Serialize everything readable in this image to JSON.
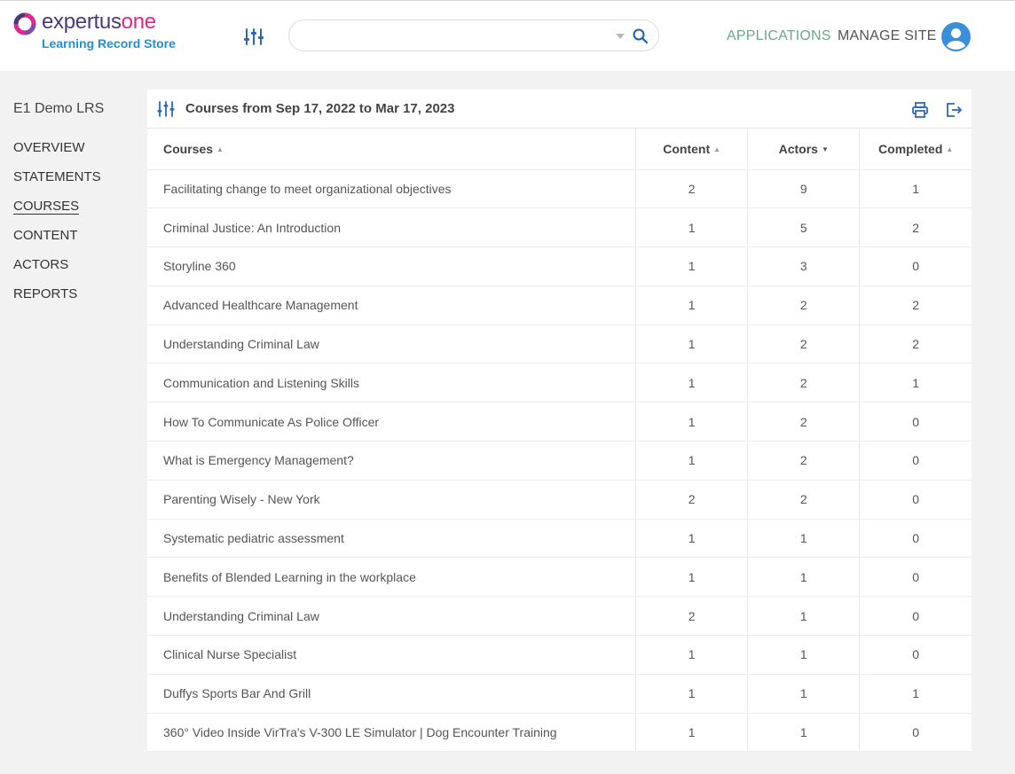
{
  "header": {
    "logo_word_1": "expertus",
    "logo_word_2": "one",
    "logo_subtitle": "Learning Record Store",
    "search": {
      "value": "",
      "placeholder": ""
    },
    "nav": {
      "applications": "APPLICATIONS",
      "manage_site": "MANAGE SITE"
    }
  },
  "colors": {
    "brand_purple": "#4a3a7a",
    "brand_pink": "#e0278a",
    "brand_blue": "#1e90d6",
    "accent_green": "#6aa88a"
  },
  "sidebar": {
    "site_name": "E1 Demo LRS",
    "items": [
      {
        "label": "OVERVIEW",
        "active": false
      },
      {
        "label": "STATEMENTS",
        "active": false
      },
      {
        "label": "COURSES",
        "active": true
      },
      {
        "label": "CONTENT",
        "active": false
      },
      {
        "label": "ACTORS",
        "active": false
      },
      {
        "label": "REPORTS",
        "active": false
      }
    ]
  },
  "panel": {
    "title": "Courses from Sep 17, 2022 to Mar 17, 2023",
    "columns": [
      {
        "label": "Courses",
        "sort": "none"
      },
      {
        "label": "Content",
        "sort": "none"
      },
      {
        "label": "Actors",
        "sort": "desc"
      },
      {
        "label": "Completed",
        "sort": "none"
      }
    ],
    "rows": [
      {
        "course": "Facilitating change to meet organizational objectives",
        "content": "2",
        "actors": "9",
        "completed": "1"
      },
      {
        "course": "Criminal Justice: An Introduction",
        "content": "1",
        "actors": "5",
        "completed": "2"
      },
      {
        "course": "Storyline 360",
        "content": "1",
        "actors": "3",
        "completed": "0"
      },
      {
        "course": "Advanced Healthcare Management",
        "content": "1",
        "actors": "2",
        "completed": "2"
      },
      {
        "course": "Understanding Criminal Law",
        "content": "1",
        "actors": "2",
        "completed": "2"
      },
      {
        "course": "Communication and Listening Skills",
        "content": "1",
        "actors": "2",
        "completed": "1"
      },
      {
        "course": "How To Communicate As Police Officer",
        "content": "1",
        "actors": "2",
        "completed": "0"
      },
      {
        "course": "What is Emergency Management?",
        "content": "1",
        "actors": "2",
        "completed": "0"
      },
      {
        "course": "Parenting Wisely - New York",
        "content": "2",
        "actors": "2",
        "completed": "0"
      },
      {
        "course": "Systematic pediatric assessment",
        "content": "1",
        "actors": "1",
        "completed": "0"
      },
      {
        "course": "Benefits of Blended Learning in the workplace",
        "content": "1",
        "actors": "1",
        "completed": "0"
      },
      {
        "course": "Understanding Criminal Law",
        "content": "2",
        "actors": "1",
        "completed": "0"
      },
      {
        "course": "Clinical Nurse Specialist",
        "content": "1",
        "actors": "1",
        "completed": "0"
      },
      {
        "course": "Duffys Sports Bar And Grill",
        "content": "1",
        "actors": "1",
        "completed": "1"
      },
      {
        "course": "360° Video Inside VirTra's V-300 LE Simulator | Dog Encounter Training",
        "content": "1",
        "actors": "1",
        "completed": "0"
      }
    ]
  }
}
